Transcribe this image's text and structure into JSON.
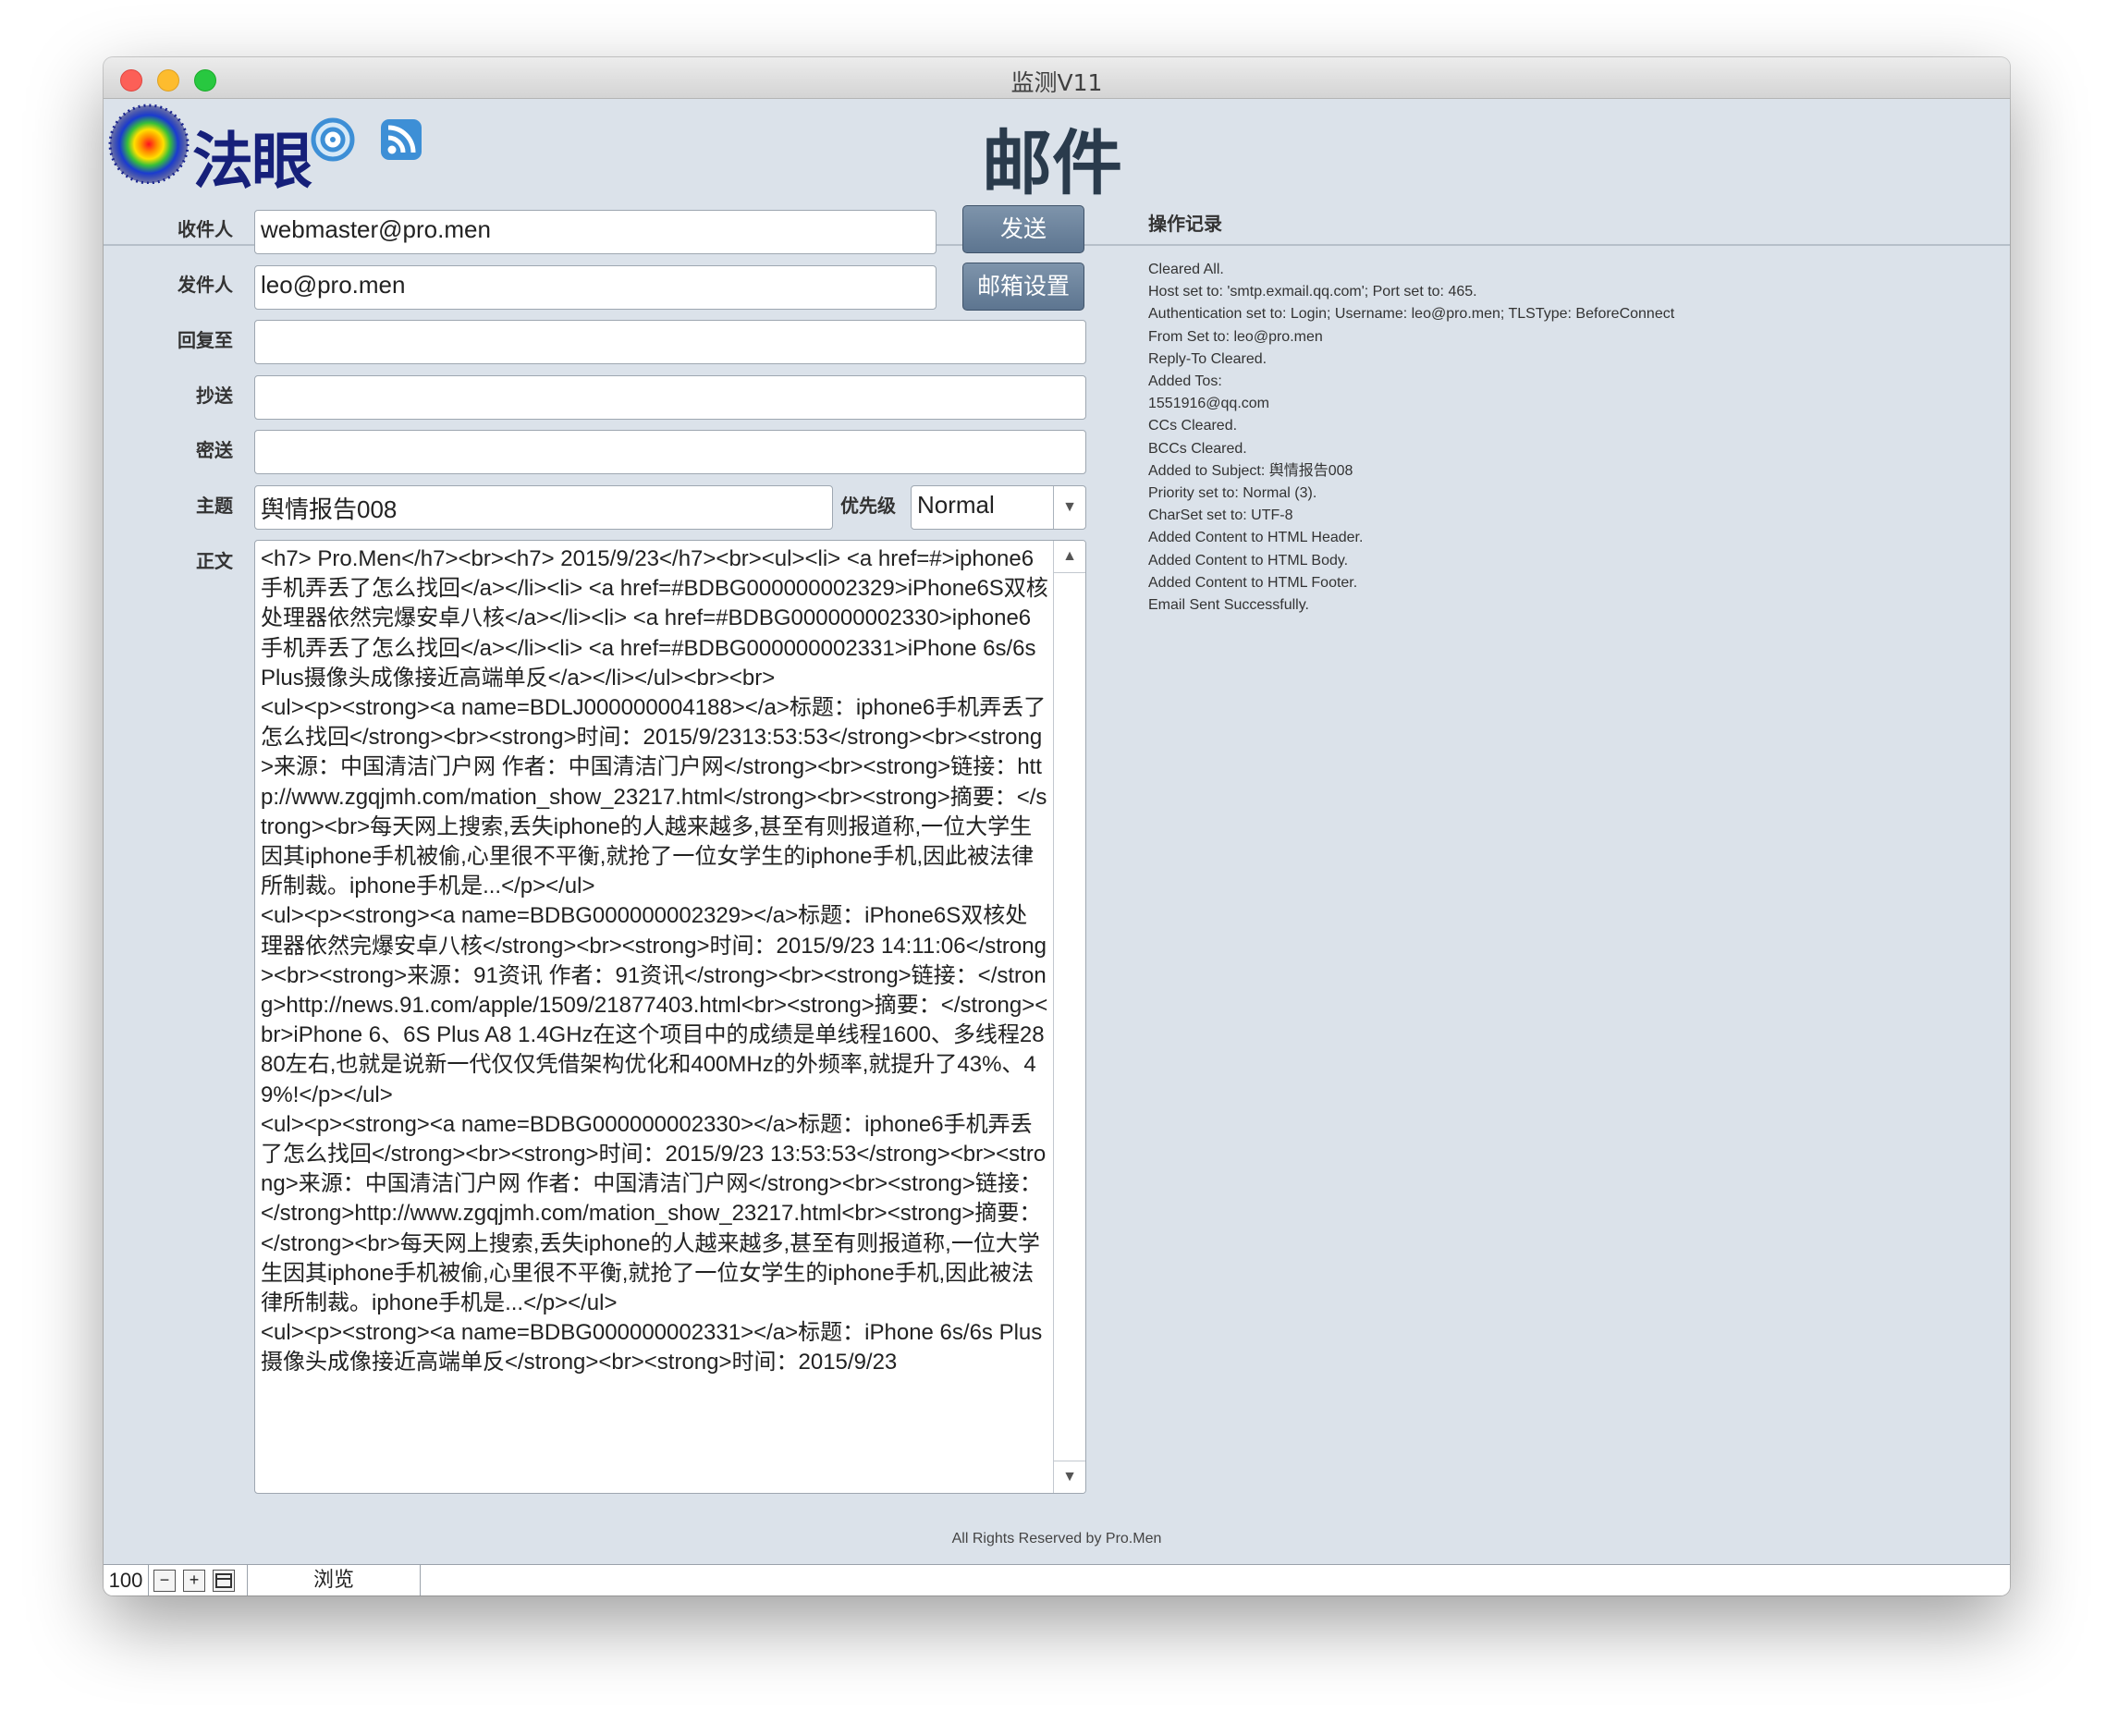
{
  "window": {
    "title": "监测V11"
  },
  "header": {
    "logo_text": "法眼",
    "page_title": "邮件"
  },
  "form": {
    "to_label": "收件人",
    "to_value": "webmaster@pro.men",
    "from_label": "发件人",
    "from_value": "leo@pro.men",
    "reply_to_label": "回复至",
    "reply_to_value": "",
    "cc_label": "抄送",
    "cc_value": "",
    "bcc_label": "密送",
    "bcc_value": "",
    "subject_label": "主题",
    "subject_value": "舆情报告008",
    "priority_label": "优先级",
    "priority_value": "Normal",
    "body_label": "正文",
    "body_value": "<h7> Pro.Men</h7><br><h7> 2015/9/23</h7><br><ul><li> <a href=#>iphone6手机弄丢了怎么找回</a></li><li> <a href=#BDBG000000002329>iPhone6S双核处理器依然完爆安卓八核</a></li><li> <a href=#BDBG000000002330>iphone6手机弄丢了怎么找回</a></li><li> <a href=#BDBG000000002331>iPhone 6s/6s Plus摄像头成像接近高端单反</a></li></ul><br><br>\n<ul><p><strong><a name=BDLJ000000004188></a>标题：iphone6手机弄丢了怎么找回</strong><br><strong>时间：2015/9/2313:53:53</strong><br><strong>来源：中国清洁门户网 作者：中国清洁门户网</strong><br><strong>链接：http://www.zgqjmh.com/mation_show_23217.html</strong><br><strong>摘要：</strong><br>每天网上搜索,丢失iphone的人越来越多,甚至有则报道称,一位大学生因其iphone手机被偷,心里很不平衡,就抢了一位女学生的iphone手机,因此被法律所制裁。iphone手机是...</p></ul>\n<ul><p><strong><a name=BDBG000000002329></a>标题：iPhone6S双核处理器依然完爆安卓八核</strong><br><strong>时间：2015/9/23 14:11:06</strong><br><strong>来源：91资讯 作者：91资讯</strong><br><strong>链接：</strong>http://news.91.com/apple/1509/21877403.html<br><strong>摘要：</strong><br>iPhone 6、6S Plus A8 1.4GHz在这个项目中的成绩是单线程1600、多线程2880左右,也就是说新一代仅仅凭借架构优化和400MHz的外频率,就提升了43%、49%!</p></ul>\n<ul><p><strong><a name=BDBG000000002330></a>标题：iphone6手机弄丢了怎么找回</strong><br><strong>时间：2015/9/23 13:53:53</strong><br><strong>来源：中国清洁门户网 作者：中国清洁门户网</strong><br><strong>链接：</strong>http://www.zgqjmh.com/mation_show_23217.html<br><strong>摘要：</strong><br>每天网上搜索,丢失iphone的人越来越多,甚至有则报道称,一位大学生因其iphone手机被偷,心里很不平衡,就抢了一位女学生的iphone手机,因此被法律所制裁。iphone手机是...</p></ul>\n<ul><p><strong><a name=BDBG000000002331></a>标题：iPhone 6s/6s Plus摄像头成像接近高端单反</strong><br><strong>时间：2015/9/23"
  },
  "buttons": {
    "send": "发送",
    "mail_settings": "邮箱设置"
  },
  "log": {
    "title": "操作记录",
    "entries": [
      "Cleared All.",
      "Host set to: 'smtp.exmail.qq.com'; Port set to: 465.",
      "Authentication set to: Login; Username: leo@pro.men; TLSType: BeforeConnect",
      "From Set to: leo@pro.men",
      "Reply-To Cleared.",
      "Added Tos:",
      "1551916@qq.com",
      "CCs Cleared.",
      "BCCs Cleared.",
      "Added to Subject: 舆情报告008",
      "Priority set to: Normal (3).",
      "CharSet set to: UTF-8",
      "Added Content to HTML Header.",
      "Added Content to HTML Body.",
      "Added Content to HTML Footer.",
      "Email Sent Successfully."
    ]
  },
  "footer": {
    "copyright": "All Rights Reserved by Pro.Men"
  },
  "statusbar": {
    "zoom": "100",
    "tab_label": "浏览"
  },
  "colors": {
    "background": "#dbe2ea",
    "button": "#6a819b",
    "logo_text": "#16207a",
    "accent_icon": "#3d8fd6"
  },
  "icons": [
    "target-icon",
    "rss-icon",
    "zoom-out-icon",
    "zoom-in-icon",
    "layout-icon"
  ]
}
